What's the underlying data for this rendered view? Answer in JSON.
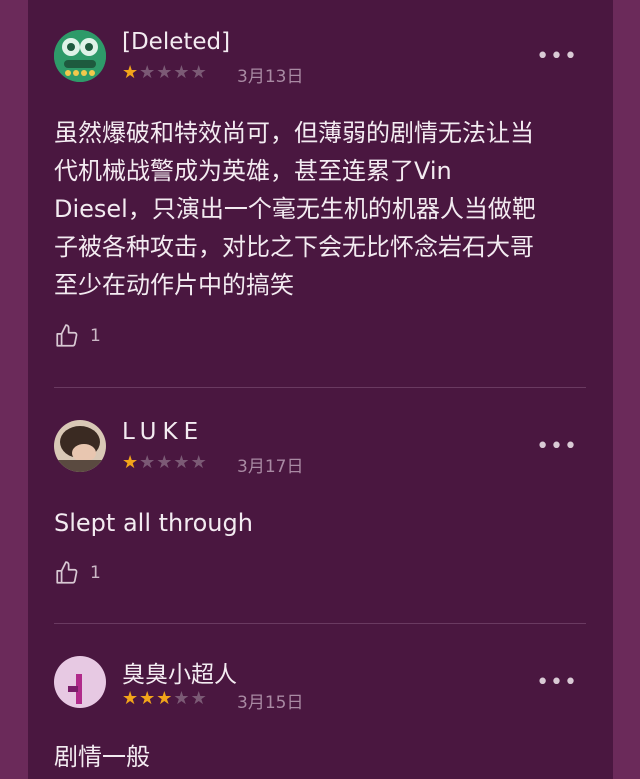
{
  "reviews": [
    {
      "name": "[Deleted]",
      "rating": 1,
      "date": "3月13日",
      "text_lines": [
        "虽然爆破和特效尚可，但薄弱的剧情无法让当",
        "代机械战警成为英雄，甚至连累了Vin",
        "Diesel，只演出一个毫无生机的机器人当做靶",
        "子被各种攻击，对比之下会无比怀念岩石大哥",
        "至少在动作片中的搞笑"
      ],
      "likes": "1",
      "avatar": "green-monster-avatar"
    },
    {
      "name": "LUKE",
      "rating": 1,
      "date": "3月17日",
      "text_lines": [
        "Slept all through"
      ],
      "likes": "1",
      "avatar": "photo-avatar"
    },
    {
      "name": "臭臭小超人",
      "rating": 3,
      "date": "3月15日",
      "text_lines": [
        "剧情一般"
      ],
      "likes": "",
      "avatar": "pink-avatar"
    }
  ],
  "more_label": "•••",
  "colors": {
    "background": "#6b2a5a",
    "panel": "#4a1740",
    "star_on": "#f2a51a",
    "star_off": "#7b5a75"
  }
}
